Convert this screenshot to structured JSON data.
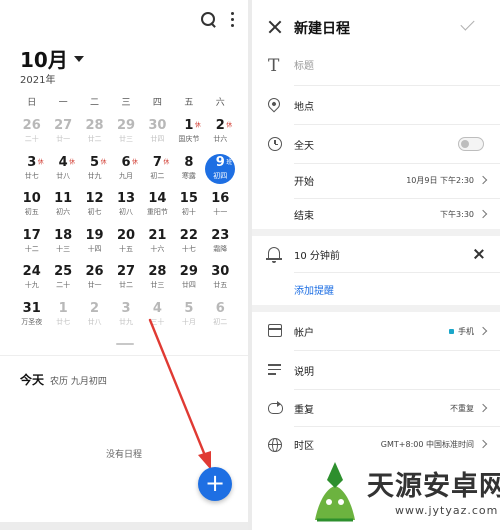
{
  "calendar": {
    "month_label": "10月",
    "year_label": "2021年",
    "weekdays": [
      "日",
      "一",
      "二",
      "三",
      "四",
      "五",
      "六"
    ],
    "weeks": [
      [
        {
          "d": "26",
          "s": "二十",
          "dim": true
        },
        {
          "d": "27",
          "s": "廿一",
          "dim": true
        },
        {
          "d": "28",
          "s": "廿二",
          "dim": true
        },
        {
          "d": "29",
          "s": "廿三",
          "dim": true
        },
        {
          "d": "30",
          "s": "廿四",
          "dim": true
        },
        {
          "d": "1",
          "s": "国庆节",
          "b": "休"
        },
        {
          "d": "2",
          "s": "廿六",
          "b": "休"
        }
      ],
      [
        {
          "d": "3",
          "s": "廿七",
          "b": "休"
        },
        {
          "d": "4",
          "s": "廿八",
          "b": "休"
        },
        {
          "d": "5",
          "s": "廿九",
          "b": "休"
        },
        {
          "d": "6",
          "s": "九月",
          "b": "休"
        },
        {
          "d": "7",
          "s": "初二",
          "b": "休"
        },
        {
          "d": "8",
          "s": "寒露"
        },
        {
          "d": "9",
          "s": "初四",
          "b": "班",
          "selected": true
        }
      ],
      [
        {
          "d": "10",
          "s": "初五"
        },
        {
          "d": "11",
          "s": "初六"
        },
        {
          "d": "12",
          "s": "初七"
        },
        {
          "d": "13",
          "s": "初八"
        },
        {
          "d": "14",
          "s": "重阳节"
        },
        {
          "d": "15",
          "s": "初十"
        },
        {
          "d": "16",
          "s": "十一"
        }
      ],
      [
        {
          "d": "17",
          "s": "十二"
        },
        {
          "d": "18",
          "s": "十三"
        },
        {
          "d": "19",
          "s": "十四"
        },
        {
          "d": "20",
          "s": "十五"
        },
        {
          "d": "21",
          "s": "十六"
        },
        {
          "d": "22",
          "s": "十七"
        },
        {
          "d": "23",
          "s": "霜降"
        }
      ],
      [
        {
          "d": "24",
          "s": "十九"
        },
        {
          "d": "25",
          "s": "二十"
        },
        {
          "d": "26",
          "s": "廿一"
        },
        {
          "d": "27",
          "s": "廿二"
        },
        {
          "d": "28",
          "s": "廿三"
        },
        {
          "d": "29",
          "s": "廿四"
        },
        {
          "d": "30",
          "s": "廿五"
        }
      ],
      [
        {
          "d": "31",
          "s": "万圣夜"
        },
        {
          "d": "1",
          "s": "廿七",
          "dim": true
        },
        {
          "d": "2",
          "s": "廿八",
          "dim": true
        },
        {
          "d": "3",
          "s": "廿九",
          "dim": true
        },
        {
          "d": "4",
          "s": "三十",
          "dim": true
        },
        {
          "d": "5",
          "s": "十月",
          "dim": true
        },
        {
          "d": "6",
          "s": "初二",
          "dim": true
        }
      ]
    ],
    "today_label": "今天",
    "today_lunar": "农历 九月初四",
    "no_events": "没有日程",
    "fab_symbol": "+"
  },
  "new_event": {
    "title": "新建日程",
    "title_placeholder": "标题",
    "location_label": "地点",
    "all_day_label": "全天",
    "all_day_on": false,
    "start_label": "开始",
    "start_value": "10月9日 下午2:30",
    "end_label": "结束",
    "end_value": "下午3:30",
    "reminder_label": "10 分钟前",
    "add_reminder_label": "添加提醒",
    "account_label": "帐户",
    "account_value": "手机",
    "description_label": "说明",
    "repeat_label": "重复",
    "repeat_value": "不重复",
    "timezone_label": "时区",
    "timezone_value": "GMT+8:00 中国标准时间"
  },
  "watermark": {
    "site_name": "天源安卓网",
    "url": "www.jytyaz.com"
  },
  "colors": {
    "accent": "#1e6fe3",
    "arrow": "#e03a33"
  }
}
